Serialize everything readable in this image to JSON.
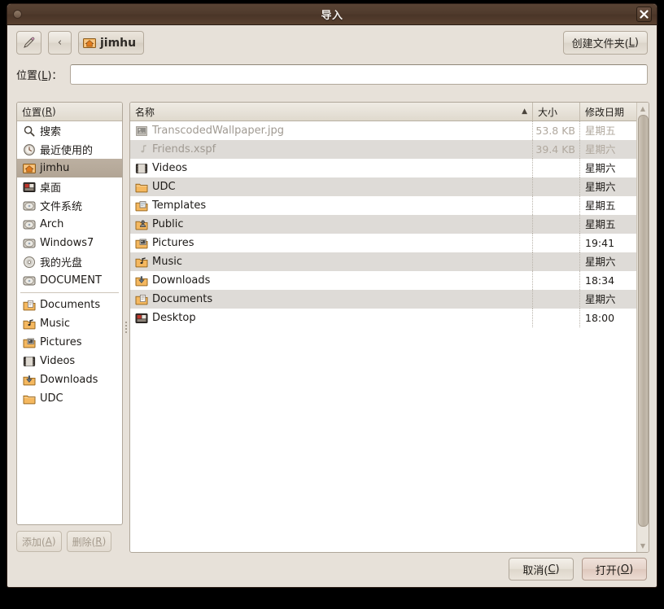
{
  "window": {
    "title": "导入",
    "close_icon": "close-icon",
    "menu_dot_icon": "window-menu-icon"
  },
  "toolbar": {
    "type_location_icon": "pencil-icon",
    "back_label": "‹",
    "path_button": {
      "icon": "home-folder-icon",
      "label": "jimhu"
    },
    "create_folder": {
      "pre": "创建文件夹(",
      "key": "L",
      "post": ")"
    }
  },
  "location": {
    "label_pre": "位置(",
    "label_key": "L",
    "label_post": ")：",
    "value": "",
    "placeholder": ""
  },
  "sidebar": {
    "header": {
      "pre": "位置(",
      "key": "R",
      "post": ")"
    },
    "items": [
      {
        "label": "搜索",
        "icon": "search-icon",
        "selected": false,
        "separator_after": false
      },
      {
        "label": "最近使用的",
        "icon": "recent-icon",
        "selected": false,
        "separator_after": false
      },
      {
        "label": "jimhu",
        "icon": "home-folder-icon",
        "selected": true,
        "separator_after": false
      },
      {
        "label": "桌面",
        "icon": "desktop-icon",
        "selected": false,
        "separator_after": false
      },
      {
        "label": "文件系统",
        "icon": "drive-icon",
        "selected": false,
        "separator_after": false
      },
      {
        "label": "Arch",
        "icon": "drive-icon",
        "selected": false,
        "separator_after": false
      },
      {
        "label": "Windows7",
        "icon": "drive-icon",
        "selected": false,
        "separator_after": false
      },
      {
        "label": "我的光盘",
        "icon": "cdrom-icon",
        "selected": false,
        "separator_after": false
      },
      {
        "label": "DOCUMENT",
        "icon": "drive-icon",
        "selected": false,
        "separator_after": true
      },
      {
        "label": "Documents",
        "icon": "documents-folder-icon",
        "selected": false,
        "separator_after": false
      },
      {
        "label": "Music",
        "icon": "music-folder-icon",
        "selected": false,
        "separator_after": false
      },
      {
        "label": "Pictures",
        "icon": "pictures-folder-icon",
        "selected": false,
        "separator_after": false
      },
      {
        "label": "Videos",
        "icon": "videos-folder-icon",
        "selected": false,
        "separator_after": false
      },
      {
        "label": "Downloads",
        "icon": "downloads-folder-icon",
        "selected": false,
        "separator_after": false
      },
      {
        "label": "UDC",
        "icon": "folder-icon",
        "selected": false,
        "separator_after": false
      }
    ],
    "add_button": {
      "pre": "添加(",
      "key": "A",
      "post": ")",
      "enabled": false
    },
    "remove_button": {
      "pre": "删除(",
      "key": "R",
      "post": ")",
      "enabled": false
    }
  },
  "filelist": {
    "columns": [
      {
        "label": "名称",
        "sorted": "asc",
        "sort_glyph": "▲"
      },
      {
        "label": "大小",
        "sorted": "",
        "sort_glyph": ""
      },
      {
        "label": "修改日期",
        "sorted": "",
        "sort_glyph": ""
      }
    ],
    "rows": [
      {
        "name": "TranscodedWallpaper.jpg",
        "size": "53.8 KB",
        "date": "星期五",
        "icon": "image-file-icon",
        "dimmed": true
      },
      {
        "name": "Friends.xspf",
        "size": "39.4 KB",
        "date": "星期六",
        "icon": "audio-file-icon",
        "dimmed": true
      },
      {
        "name": "Videos",
        "size": "",
        "date": "星期六",
        "icon": "videos-folder-icon",
        "dimmed": false
      },
      {
        "name": "UDC",
        "size": "",
        "date": "星期六",
        "icon": "folder-icon",
        "dimmed": false
      },
      {
        "name": "Templates",
        "size": "",
        "date": "星期五",
        "icon": "templates-folder-icon",
        "dimmed": false
      },
      {
        "name": "Public",
        "size": "",
        "date": "星期五",
        "icon": "public-folder-icon",
        "dimmed": false
      },
      {
        "name": "Pictures",
        "size": "",
        "date": "19:41",
        "icon": "pictures-folder-icon",
        "dimmed": false
      },
      {
        "name": "Music",
        "size": "",
        "date": "星期六",
        "icon": "music-folder-icon",
        "dimmed": false
      },
      {
        "name": "Downloads",
        "size": "",
        "date": "18:34",
        "icon": "downloads-folder-icon",
        "dimmed": false
      },
      {
        "name": "Documents",
        "size": "",
        "date": "星期六",
        "icon": "documents-folder-icon",
        "dimmed": false
      },
      {
        "name": "Desktop",
        "size": "",
        "date": "18:00",
        "icon": "desktop-icon",
        "dimmed": false
      }
    ],
    "scroll": {
      "up_glyph": "▲",
      "down_glyph": "▼",
      "thumb_top_pct": 0,
      "thumb_height_pct": 97
    }
  },
  "actions": {
    "cancel": {
      "pre": "取消(",
      "key": "C",
      "post": ")"
    },
    "open": {
      "pre": "打开(",
      "key": "O",
      "post": ")",
      "is_default": true
    }
  },
  "colors": {
    "titlebar": "#503b2d",
    "window_bg": "#e7e1d9",
    "selection": "#b2a595",
    "row_alt": "#dedbd7",
    "default_button": "#e5d2c8"
  }
}
